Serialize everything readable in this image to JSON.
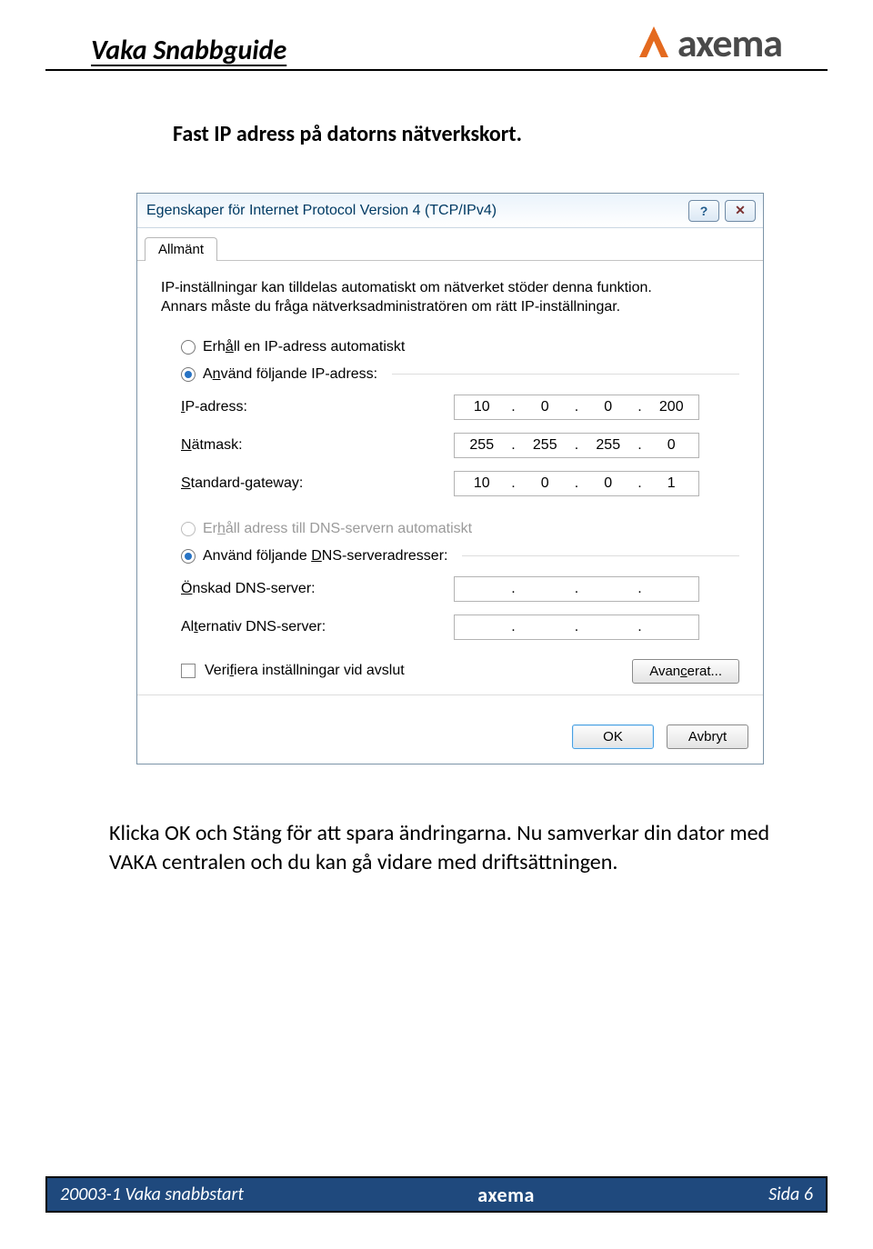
{
  "header": {
    "title": "Vaka Snabbguide",
    "logo_text": "axema"
  },
  "subtitle": "Fast IP adress på datorns nätverkskort.",
  "dialog": {
    "title": "Egenskaper för Internet Protocol Version 4 (TCP/IPv4)",
    "tab": "Allmänt",
    "info": "IP-inställningar kan tilldelas automatiskt om nätverket stöder denna funktion. Annars måste du fråga nätverksadministratören om rätt IP-inställningar.",
    "radio_auto_ip": "Erhåll en IP-adress automatiskt",
    "radio_manual_ip": "Använd följande IP-adress:",
    "fields": {
      "ip_label": "IP-adress:",
      "ip_value": [
        "10",
        "0",
        "0",
        "200"
      ],
      "mask_label": "Nätmask:",
      "mask_value": [
        "255",
        "255",
        "255",
        "0"
      ],
      "gw_label": "Standard-gateway:",
      "gw_value": [
        "10",
        "0",
        "0",
        "1"
      ]
    },
    "radio_auto_dns": "Erhåll adress till DNS-servern automatiskt",
    "radio_manual_dns": "Använd följande DNS-serveradresser:",
    "dns": {
      "pref_label": "Önskad DNS-server:",
      "pref_value": [
        "",
        "",
        "",
        ""
      ],
      "alt_label": "Alternativ DNS-server:",
      "alt_value": [
        "",
        "",
        "",
        ""
      ]
    },
    "verify_label": "Verifiera inställningar vid avslut",
    "advanced_label": "Avancerat...",
    "ok_label": "OK",
    "cancel_label": "Avbryt"
  },
  "post_text": "Klicka OK och Stäng för att spara ändringarna. Nu samverkar din dator med VAKA centralen och du kan gå vidare med driftsättningen.",
  "footer": {
    "left": "20003-1 Vaka snabbstart",
    "center": "axema",
    "right": "Sida 6"
  }
}
